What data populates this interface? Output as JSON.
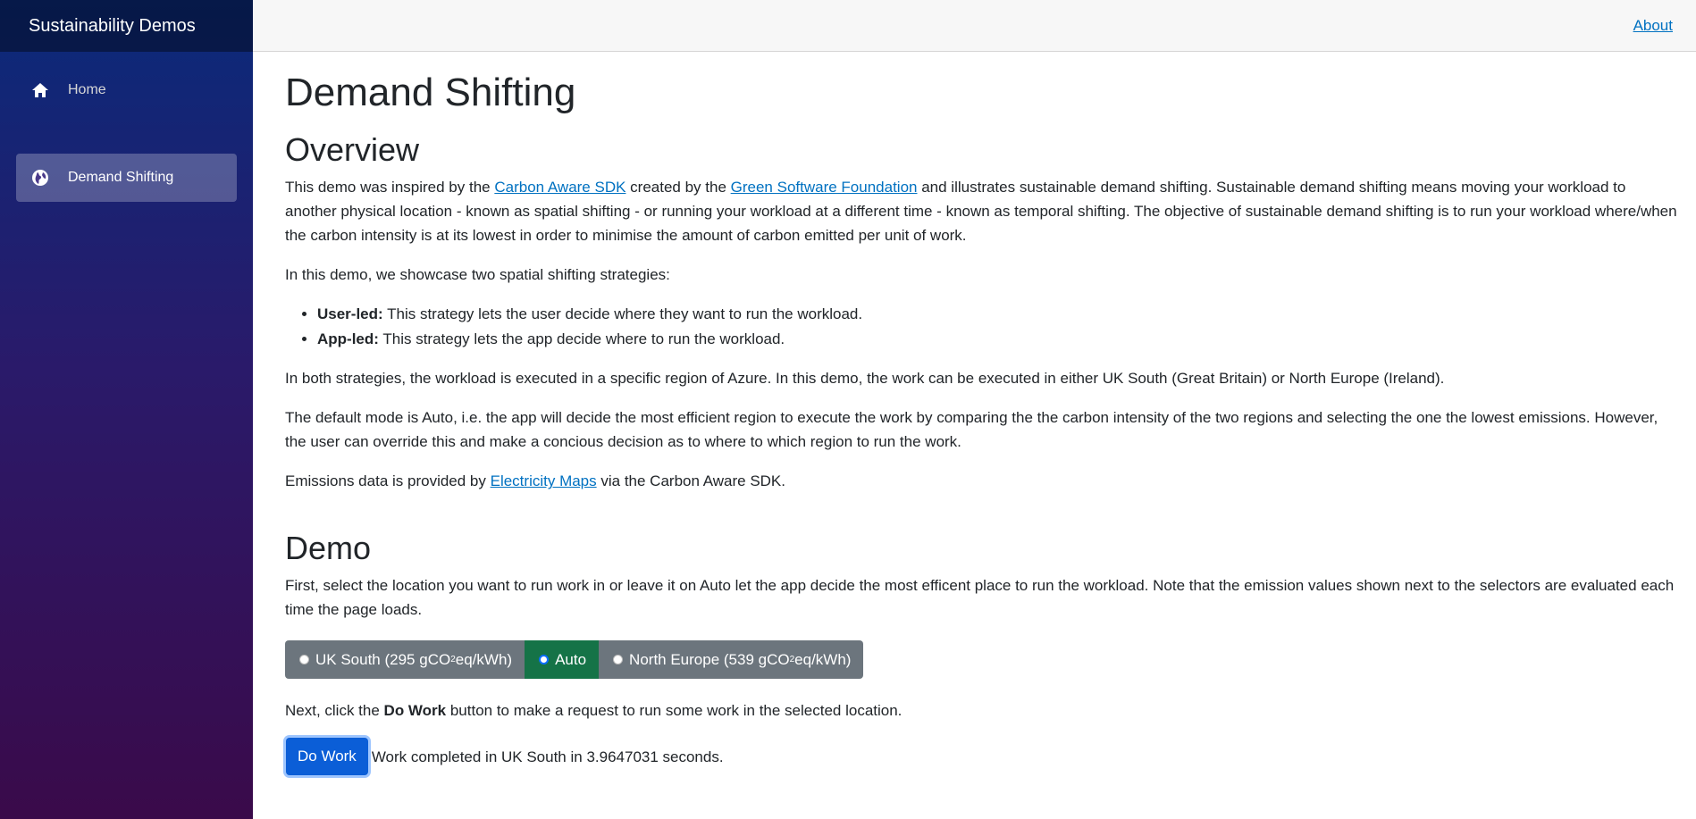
{
  "app": {
    "brand": "Sustainability Demos"
  },
  "nav": {
    "items": [
      {
        "label": "Home",
        "icon": "home-icon",
        "active": false
      },
      {
        "label": "Demand Shifting",
        "icon": "globe-icon",
        "active": true
      }
    ]
  },
  "topbar": {
    "about_label": "About"
  },
  "page": {
    "title": "Demand Shifting",
    "overview": {
      "heading": "Overview",
      "p1_a": "This demo was inspired by the ",
      "p1_link1": "Carbon Aware SDK",
      "p1_b": " created by the ",
      "p1_link2": "Green Software Foundation",
      "p1_c": " and illustrates sustainable demand shifting. Sustainable demand shifting means moving your workload to another physical location - known as spatial shifting - or running your workload at a different time - known as temporal shifting. The objective of sustainable demand shifting is to run your workload where/when the carbon intensity is at its lowest in order to minimise the amount of carbon emitted per unit of work.",
      "p2": "In this demo, we showcase two spatial shifting strategies:",
      "strategies": [
        {
          "name": "User-led:",
          "desc": " This strategy lets the user decide where they want to run the workload."
        },
        {
          "name": "App-led:",
          "desc": " This strategy lets the app decide where to run the workload."
        }
      ],
      "p3": "In both strategies, the workload is executed in a specific region of Azure. In this demo, the work can be executed in either UK South (Great Britain) or North Europe (Ireland).",
      "p4": "The default mode is Auto, i.e. the app will decide the most efficient region to execute the work by comparing the the carbon intensity of the two regions and selecting the one the lowest emissions. However, the user can override this and make a concious decision as to where to which region to run the work.",
      "p5_a": "Emissions data is provided by ",
      "p5_link": "Electricity Maps",
      "p5_b": " via the Carbon Aware SDK."
    },
    "demo": {
      "heading": "Demo",
      "p1": "First, select the location you want to run work in or leave it on Auto let the app decide the most efficent place to run the workload. Note that the emission values shown next to the selectors are evaluated each time the page loads.",
      "regions": [
        {
          "pre": "UK South (295 gCO",
          "sub": "2",
          "post": "eq/kWh)",
          "selected": false
        },
        {
          "pre": "Auto",
          "sub": "",
          "post": "",
          "selected": true
        },
        {
          "pre": "North Europe (539 gCO",
          "sub": "2",
          "post": "eq/kWh)",
          "selected": false
        }
      ],
      "p2_a": "Next, click the ",
      "p2_bold": "Do Work",
      "p2_b": " button to make a request to run some work in the selected location.",
      "button_label": "Do Work",
      "result": "Work completed in UK South in 3.9647031 seconds."
    }
  },
  "colors": {
    "link": "#0071c1",
    "region_default": "#6c757d",
    "region_selected": "#157347",
    "primary_button": "#0b5ed7"
  }
}
